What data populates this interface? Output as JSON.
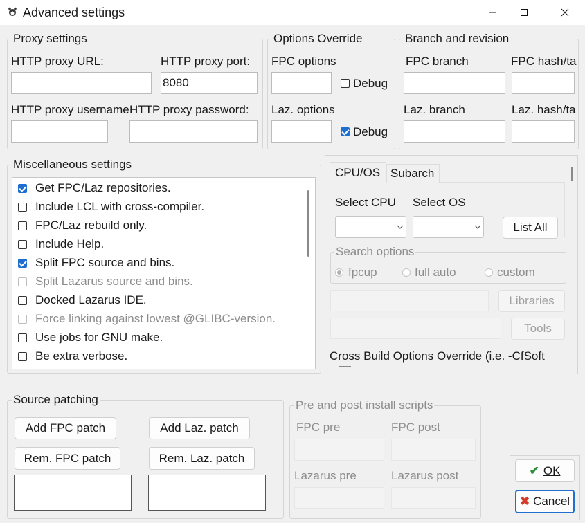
{
  "window": {
    "title": "Advanced settings",
    "app_icon": "lazarus-paw-icon"
  },
  "proxy": {
    "title": "Proxy settings",
    "url_label": "HTTP proxy URL:",
    "url_value": "",
    "port_label": "HTTP proxy port:",
    "port_value": "8080",
    "username_label": "HTTP proxy username:",
    "username_value": "",
    "password_label": "HTTP proxy password:",
    "password_value": ""
  },
  "override": {
    "title": "Options Override",
    "fpc_label": "FPC options",
    "fpc_debug_label": "Debug",
    "fpc_debug_checked": false,
    "laz_label": "Laz. options",
    "laz_debug_label": "Debug",
    "laz_debug_checked": true
  },
  "branch": {
    "title": "Branch and revision",
    "fpc_branch_label": "FPC branch",
    "fpc_hash_label": "FPC hash/ta",
    "laz_branch_label": "Laz. branch",
    "laz_hash_label": "Laz. hash/ta"
  },
  "misc": {
    "title": "Miscellaneous settings",
    "items": [
      {
        "label": "Get FPC/Laz repositories.",
        "checked": true,
        "enabled": true
      },
      {
        "label": "Include LCL with cross-compiler.",
        "checked": false,
        "enabled": true
      },
      {
        "label": "FPC/Laz rebuild only.",
        "checked": false,
        "enabled": true
      },
      {
        "label": "Include Help.",
        "checked": false,
        "enabled": true
      },
      {
        "label": "Split FPC source and bins.",
        "checked": true,
        "enabled": true
      },
      {
        "label": "Split Lazarus source and bins.",
        "checked": false,
        "enabled": false
      },
      {
        "label": "Docked Lazarus IDE.",
        "checked": false,
        "enabled": true
      },
      {
        "label": "Force linking against lowest @GLIBC-version.",
        "checked": false,
        "enabled": false
      },
      {
        "label": "Use jobs for GNU make.",
        "checked": false,
        "enabled": true
      },
      {
        "label": "Be extra verbose.",
        "checked": false,
        "enabled": true
      }
    ]
  },
  "cross": {
    "tabs": [
      "CPU/OS",
      "Subarch"
    ],
    "active_tab": "CPU/OS",
    "select_cpu_label": "Select CPU",
    "select_os_label": "Select OS",
    "list_all_label": "List All",
    "search_title": "Search options",
    "radio_options": [
      "fpcup",
      "full auto",
      "custom"
    ],
    "radio_selected": "fpcup",
    "libraries_label": "Libraries",
    "tools_label": "Tools",
    "override_label": "Cross Build Options Override (i.e. -CfSoft"
  },
  "patching": {
    "title": "Source patching",
    "add_fpc": "Add FPC patch",
    "add_laz": "Add Laz. patch",
    "rem_fpc": "Rem. FPC patch",
    "rem_laz": "Rem. Laz. patch"
  },
  "scripts": {
    "title": "Pre and post install scripts",
    "fpc_pre": "FPC pre",
    "fpc_post": "FPC post",
    "laz_pre": "Lazarus pre",
    "laz_post": "Lazarus post"
  },
  "footer": {
    "ok_label": "OK",
    "cancel_label": "Cancel"
  },
  "colors": {
    "accent": "#1f6fd0",
    "ok_check": "#2e8b3a",
    "cancel_x": "#d63a2a"
  }
}
